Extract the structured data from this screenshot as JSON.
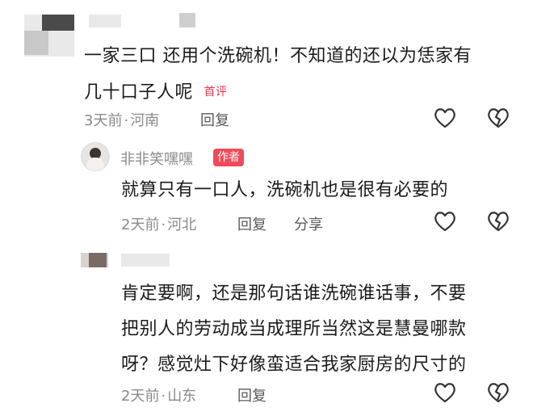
{
  "comments": [
    {
      "text_line1": "一家三口 还用个洗碗机！不知道的还以为恁家有",
      "text_line2": "几十口子人呢",
      "badge": "首评",
      "time": "3天前",
      "separator": "·",
      "location": "河南",
      "reply_label": "回复"
    },
    {
      "author": "非非笑嘿嘿",
      "author_badge": "作者",
      "text": "就算只有一口人，洗碗机也是很有必要的",
      "time": "2天前",
      "separator": "·",
      "location": "河北",
      "reply_label": "回复",
      "share_label": "分享"
    },
    {
      "text_line1": "肯定要啊，还是那句话谁洗碗谁话事，不要",
      "text_line2": "把别人的劳动成当成理所当然这是慧曼哪款",
      "text_line3": "呀？感觉灶下好像蛮适合我家厨房的尺寸的",
      "time": "2天前",
      "separator": "·",
      "location": "山东",
      "reply_label": "回复"
    }
  ],
  "icons": {
    "like": "heart-outline-icon",
    "dislike": "broken-heart-icon"
  },
  "colors": {
    "accent": "#f04a5a",
    "meta": "#8a8a8a"
  }
}
